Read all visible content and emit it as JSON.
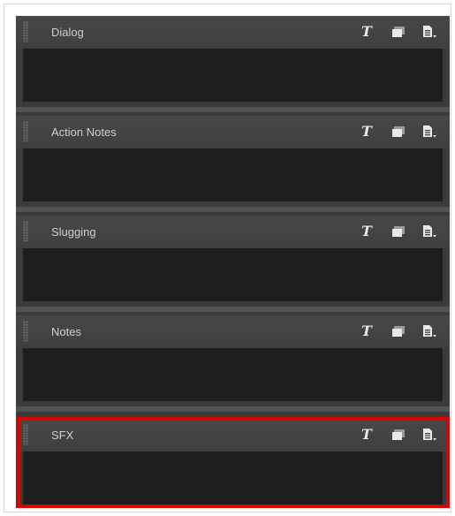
{
  "panels": [
    {
      "title": "Dialog"
    },
    {
      "title": "Action Notes"
    },
    {
      "title": "Slugging"
    },
    {
      "title": "Notes"
    },
    {
      "title": "SFX"
    }
  ],
  "toolbar_icons": [
    "text-format-icon",
    "copy-icon",
    "menu-icon"
  ],
  "colors": {
    "panel_background": "#3b3b3b",
    "header": "#444444",
    "text_area": "#1e1e1e",
    "title_text": "#cfcfcf",
    "highlight": "#e00000"
  }
}
